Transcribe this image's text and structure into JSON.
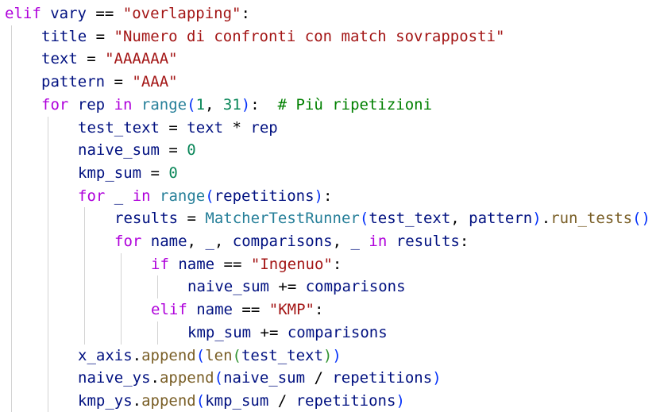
{
  "editor": {
    "language": "python",
    "theme_colors": {
      "keyword_control": "#af00db",
      "keyword": "#0000ff",
      "string": "#a31515",
      "number": "#098658",
      "function": "#795e26",
      "class": "#267f99",
      "comment": "#008000",
      "variable": "#001080",
      "operator": "#000000",
      "indent_guide": "#d3d3d3"
    },
    "lines": [
      {
        "indent": 0,
        "tokens": [
          {
            "t": "elif",
            "k": "kw"
          },
          {
            "t": " ",
            "k": "op"
          },
          {
            "t": "vary",
            "k": "var"
          },
          {
            "t": " == ",
            "k": "op"
          },
          {
            "t": "\"overlapping\"",
            "k": "str"
          },
          {
            "t": ":",
            "k": "op"
          }
        ]
      },
      {
        "indent": 1,
        "tokens": [
          {
            "t": "title",
            "k": "var"
          },
          {
            "t": " = ",
            "k": "op"
          },
          {
            "t": "\"Numero di confronti con match sovrapposti\"",
            "k": "str"
          }
        ]
      },
      {
        "indent": 1,
        "tokens": [
          {
            "t": "text",
            "k": "var"
          },
          {
            "t": " = ",
            "k": "op"
          },
          {
            "t": "\"AAAAAA\"",
            "k": "str"
          }
        ]
      },
      {
        "indent": 1,
        "tokens": [
          {
            "t": "pattern",
            "k": "var"
          },
          {
            "t": " = ",
            "k": "op"
          },
          {
            "t": "\"AAA\"",
            "k": "str"
          }
        ]
      },
      {
        "indent": 1,
        "tokens": [
          {
            "t": "for",
            "k": "kw"
          },
          {
            "t": " ",
            "k": "op"
          },
          {
            "t": "rep",
            "k": "var"
          },
          {
            "t": " ",
            "k": "op"
          },
          {
            "t": "in",
            "k": "kw"
          },
          {
            "t": " ",
            "k": "op"
          },
          {
            "t": "range",
            "k": "cls"
          },
          {
            "t": "(",
            "k": "br1"
          },
          {
            "t": "1",
            "k": "num"
          },
          {
            "t": ", ",
            "k": "op"
          },
          {
            "t": "31",
            "k": "num"
          },
          {
            "t": ")",
            "k": "br1"
          },
          {
            "t": ":  ",
            "k": "op"
          },
          {
            "t": "# Più ripetizioni",
            "k": "cmt"
          }
        ]
      },
      {
        "indent": 2,
        "tokens": [
          {
            "t": "test_text",
            "k": "var"
          },
          {
            "t": " = ",
            "k": "op"
          },
          {
            "t": "text",
            "k": "var"
          },
          {
            "t": " * ",
            "k": "op"
          },
          {
            "t": "rep",
            "k": "var"
          }
        ]
      },
      {
        "indent": 2,
        "tokens": [
          {
            "t": "naive_sum",
            "k": "var"
          },
          {
            "t": " = ",
            "k": "op"
          },
          {
            "t": "0",
            "k": "num"
          }
        ]
      },
      {
        "indent": 2,
        "tokens": [
          {
            "t": "kmp_sum",
            "k": "var"
          },
          {
            "t": " = ",
            "k": "op"
          },
          {
            "t": "0",
            "k": "num"
          }
        ]
      },
      {
        "indent": 2,
        "tokens": [
          {
            "t": "for",
            "k": "kw"
          },
          {
            "t": " ",
            "k": "op"
          },
          {
            "t": "_",
            "k": "var"
          },
          {
            "t": " ",
            "k": "op"
          },
          {
            "t": "in",
            "k": "kw"
          },
          {
            "t": " ",
            "k": "op"
          },
          {
            "t": "range",
            "k": "cls"
          },
          {
            "t": "(",
            "k": "br1"
          },
          {
            "t": "repetitions",
            "k": "var"
          },
          {
            "t": ")",
            "k": "br1"
          },
          {
            "t": ":",
            "k": "op"
          }
        ]
      },
      {
        "indent": 3,
        "tokens": [
          {
            "t": "results",
            "k": "var"
          },
          {
            "t": " = ",
            "k": "op"
          },
          {
            "t": "MatcherTestRunner",
            "k": "cls"
          },
          {
            "t": "(",
            "k": "br1"
          },
          {
            "t": "test_text",
            "k": "var"
          },
          {
            "t": ", ",
            "k": "op"
          },
          {
            "t": "pattern",
            "k": "var"
          },
          {
            "t": ")",
            "k": "br1"
          },
          {
            "t": ".",
            "k": "op"
          },
          {
            "t": "run_tests",
            "k": "fn"
          },
          {
            "t": "()",
            "k": "br1"
          }
        ]
      },
      {
        "indent": 3,
        "tokens": [
          {
            "t": "for",
            "k": "kw"
          },
          {
            "t": " ",
            "k": "op"
          },
          {
            "t": "name",
            "k": "var"
          },
          {
            "t": ", ",
            "k": "op"
          },
          {
            "t": "_",
            "k": "var"
          },
          {
            "t": ", ",
            "k": "op"
          },
          {
            "t": "comparisons",
            "k": "var"
          },
          {
            "t": ", ",
            "k": "op"
          },
          {
            "t": "_",
            "k": "var"
          },
          {
            "t": " ",
            "k": "op"
          },
          {
            "t": "in",
            "k": "kw"
          },
          {
            "t": " ",
            "k": "op"
          },
          {
            "t": "results",
            "k": "var"
          },
          {
            "t": ":",
            "k": "op"
          }
        ]
      },
      {
        "indent": 4,
        "tokens": [
          {
            "t": "if",
            "k": "kw"
          },
          {
            "t": " ",
            "k": "op"
          },
          {
            "t": "name",
            "k": "var"
          },
          {
            "t": " == ",
            "k": "op"
          },
          {
            "t": "\"Ingenuo\"",
            "k": "str"
          },
          {
            "t": ":",
            "k": "op"
          }
        ]
      },
      {
        "indent": 5,
        "tokens": [
          {
            "t": "naive_sum",
            "k": "var"
          },
          {
            "t": " += ",
            "k": "op"
          },
          {
            "t": "comparisons",
            "k": "var"
          }
        ]
      },
      {
        "indent": 4,
        "tokens": [
          {
            "t": "elif",
            "k": "kw"
          },
          {
            "t": " ",
            "k": "op"
          },
          {
            "t": "name",
            "k": "var"
          },
          {
            "t": " == ",
            "k": "op"
          },
          {
            "t": "\"KMP\"",
            "k": "str"
          },
          {
            "t": ":",
            "k": "op"
          }
        ]
      },
      {
        "indent": 5,
        "tokens": [
          {
            "t": "kmp_sum",
            "k": "var"
          },
          {
            "t": " += ",
            "k": "op"
          },
          {
            "t": "comparisons",
            "k": "var"
          }
        ]
      },
      {
        "indent": 2,
        "tokens": [
          {
            "t": "x_axis",
            "k": "var"
          },
          {
            "t": ".",
            "k": "op"
          },
          {
            "t": "append",
            "k": "fn"
          },
          {
            "t": "(",
            "k": "br1"
          },
          {
            "t": "len",
            "k": "fn"
          },
          {
            "t": "(",
            "k": "br2"
          },
          {
            "t": "test_text",
            "k": "var"
          },
          {
            "t": ")",
            "k": "br2"
          },
          {
            "t": ")",
            "k": "br1"
          }
        ]
      },
      {
        "indent": 2,
        "tokens": [
          {
            "t": "naive_ys",
            "k": "var"
          },
          {
            "t": ".",
            "k": "op"
          },
          {
            "t": "append",
            "k": "fn"
          },
          {
            "t": "(",
            "k": "br1"
          },
          {
            "t": "naive_sum",
            "k": "var"
          },
          {
            "t": " / ",
            "k": "op"
          },
          {
            "t": "repetitions",
            "k": "var"
          },
          {
            "t": ")",
            "k": "br1"
          }
        ]
      },
      {
        "indent": 2,
        "tokens": [
          {
            "t": "kmp_ys",
            "k": "var"
          },
          {
            "t": ".",
            "k": "op"
          },
          {
            "t": "append",
            "k": "fn"
          },
          {
            "t": "(",
            "k": "br1"
          },
          {
            "t": "kmp_sum",
            "k": "var"
          },
          {
            "t": " / ",
            "k": "op"
          },
          {
            "t": "repetitions",
            "k": "var"
          },
          {
            "t": ")",
            "k": "br1"
          }
        ]
      }
    ]
  }
}
